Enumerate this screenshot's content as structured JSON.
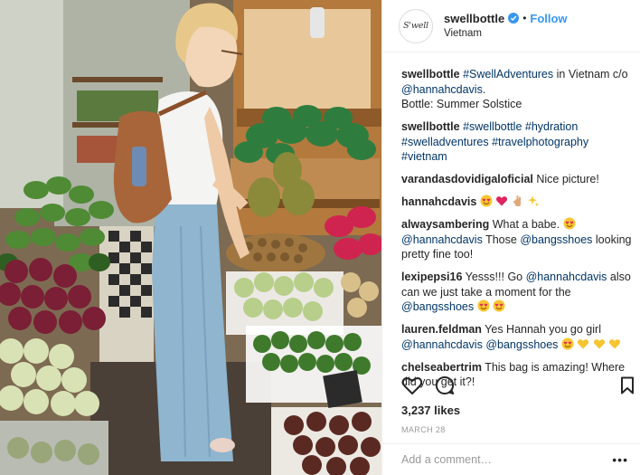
{
  "header": {
    "avatar_text": "S'well",
    "username": "swellbottle",
    "follow": "Follow",
    "location": "Vietnam"
  },
  "comments": [
    {
      "user": "swellbottle",
      "hashtag": "#SwellAdventures",
      "text1": " in Vietnam c/o ",
      "mention": "@hannahcdavis",
      "text2": ".",
      "line2": "Bottle: Summer Solstice"
    },
    {
      "user": "swellbottle",
      "tags": [
        "#swellbottle",
        "#hydration",
        "#swelladventures",
        "#travelphotography",
        "#vietnam"
      ]
    },
    {
      "user": "varandasdovidigaloficial",
      "text": "Nice picture!"
    },
    {
      "user": "hannahcdavis",
      "emojis": [
        "heart-eyes-emoji",
        "red-heart-emoji",
        "hand-emoji",
        "sparkles-emoji"
      ]
    },
    {
      "user": "alwaysambering",
      "text1": "What a babe. ",
      "mention1": "@hannahcdavis",
      "text2": " Those ",
      "mention2": "@bangsshoes",
      "text3": " looking pretty fine too!"
    },
    {
      "user": "lexipepsi16",
      "text1": "Yesss!!! Go ",
      "mention1": "@hannahcdavis",
      "text2": " also can we just take a moment for the ",
      "mention2": "@bangsshoes"
    },
    {
      "user": "lauren.feldman",
      "text1": "Yes Hannah you go girl ",
      "mention1": "@hannahcdavis",
      "mention2": "@bangsshoes"
    },
    {
      "user": "chelseabertrim",
      "text": "This bag is amazing! Where did you get it?!"
    }
  ],
  "likes": "3,237 likes",
  "date": "MARCH 28",
  "add_comment_placeholder": "Add a comment…",
  "more_label": "•••",
  "colors": {
    "link": "#003569",
    "follow": "#3897f0",
    "verified": "#3897f0"
  },
  "icons": [
    "heart-icon",
    "comment-icon",
    "save-icon",
    "verified-badge-icon",
    "more-options-icon"
  ]
}
